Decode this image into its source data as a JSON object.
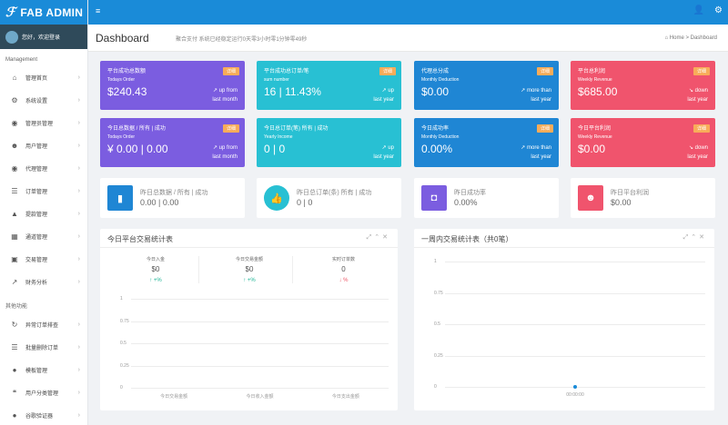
{
  "brand": {
    "name": "FAB ADMIN"
  },
  "user": {
    "greeting": "您好，欢迎登录"
  },
  "sidebar": {
    "section1": "Management",
    "items1": [
      {
        "label": "管理首页",
        "icon": "home-icon",
        "glyph": "⌂"
      },
      {
        "label": "系统设置",
        "icon": "gears-icon",
        "glyph": "⚙"
      },
      {
        "label": "管理员管理",
        "icon": "user-circle-icon",
        "glyph": "◉"
      },
      {
        "label": "用户管理",
        "icon": "users-icon",
        "glyph": "☻"
      },
      {
        "label": "代理管理",
        "icon": "agent-icon",
        "glyph": "◉"
      },
      {
        "label": "订单管理",
        "icon": "list-icon",
        "glyph": "☰"
      },
      {
        "label": "提款管理",
        "icon": "money-bag-icon",
        "glyph": "▲"
      },
      {
        "label": "通道管理",
        "icon": "bank-icon",
        "glyph": "▦"
      },
      {
        "label": "交易管理",
        "icon": "calendar-icon",
        "glyph": "▣"
      },
      {
        "label": "财务分析",
        "icon": "line-chart-icon",
        "glyph": "↗"
      }
    ],
    "section2": "其他功能",
    "items2": [
      {
        "label": "异常订单排查",
        "icon": "refresh-icon",
        "glyph": "↻"
      },
      {
        "label": "批量删除订单",
        "icon": "list-alt-icon",
        "glyph": "☰"
      },
      {
        "label": "模板管理",
        "icon": "apple-icon",
        "glyph": "●"
      },
      {
        "label": "用户分类管理",
        "icon": "comments-icon",
        "glyph": "❝"
      },
      {
        "label": "谷歌验证器",
        "icon": "lock-icon",
        "glyph": "●"
      }
    ]
  },
  "header": {
    "title": "Dashboard",
    "subtitle": "聚合支付 系统已经稳定运行0天零3小时零1分钟零49秒",
    "breadcrumb_home": "Home",
    "breadcrumb_current": "Dashboard"
  },
  "cards_row1": [
    {
      "title": "平台成功总数额",
      "badge": "详细",
      "sub": "Todays Order",
      "value": "$240.43",
      "trend": "up from",
      "trend2": "last month",
      "color": "purple"
    },
    {
      "title": "平台成功总订单/笔",
      "badge": "详细",
      "sub": "sum number",
      "value": "16 | 11.43%",
      "trend": "up",
      "trend2": "last year",
      "color": "cyan"
    },
    {
      "title": "代理总分成",
      "badge": "详细",
      "sub": "Monthly Deduction",
      "value": "$0.00",
      "trend": "more than",
      "trend2": "last year",
      "color": "blue"
    },
    {
      "title": "平台总利润",
      "badge": "详细",
      "sub": "Weekly Revenue",
      "value": "$685.00",
      "trend": "down",
      "trend2": "last year",
      "color": "red"
    }
  ],
  "cards_row2": [
    {
      "title": "今日总数据 / 所有 | 成功",
      "badge": "详细",
      "sub": "Todays Order",
      "value": "¥ 0.00 | 0.00",
      "trend": "up from",
      "trend2": "last month",
      "color": "purple"
    },
    {
      "title": "今日总订单(笔) 所有 | 成功",
      "badge": "",
      "sub": "Yearly Income",
      "value": "0 | 0",
      "trend": "up",
      "trend2": "last year",
      "color": "cyan"
    },
    {
      "title": "今日成功率",
      "badge": "详细",
      "sub": "Monthly Deduction",
      "value": "0.00%",
      "trend": "more than",
      "trend2": "last year",
      "color": "blue"
    },
    {
      "title": "今日平台利润",
      "badge": "详细",
      "sub": "Weekly Revenue",
      "value": "$0.00",
      "trend": "down",
      "trend2": "last year",
      "color": "red"
    }
  ],
  "white_cards": [
    {
      "title": "昨日总数据 / 所有 | 成功",
      "value": "0.00 | 0.00",
      "icon": "bar-chart-icon",
      "glyph": "▮",
      "bg": "#1f86d4"
    },
    {
      "title": "昨日总订单(条) 所有 | 成功",
      "value": "0 | 0",
      "icon": "thumbs-up-icon",
      "glyph": "👍",
      "bg": "#28c0d3"
    },
    {
      "title": "昨日成功率",
      "value": "0.00%",
      "icon": "shopping-bag-icon",
      "glyph": "◘",
      "bg": "#7b5de0"
    },
    {
      "title": "昨日平台利润",
      "value": "$0.00",
      "icon": "users-icon",
      "glyph": "☻",
      "bg": "#f0546d"
    }
  ],
  "panel_left": {
    "title": "今日平台交易统计表",
    "stats": [
      {
        "label": "今日入金",
        "value": "$0",
        "pct": "+%",
        "dir": "up"
      },
      {
        "label": "今日交易金额",
        "value": "$0",
        "pct": "+%",
        "dir": "up"
      },
      {
        "label": "实时订单数",
        "value": "0",
        "pct": "%",
        "dir": "down"
      }
    ],
    "chart_data": {
      "type": "bar",
      "categories": [
        "今日交易金额",
        "今日收入金额",
        "今日支出金额"
      ],
      "values": [
        0,
        0,
        0
      ],
      "ylim": [
        0,
        1
      ],
      "yticks": [
        "1",
        "0.75",
        "0.5",
        "0.25",
        "0"
      ]
    }
  },
  "panel_right": {
    "title": "一周内交易统计表（共0笔）",
    "chart_data": {
      "type": "line",
      "x": [
        "00:00:00"
      ],
      "values": [
        0
      ],
      "ylim": [
        0,
        1
      ],
      "yticks": [
        "1",
        "0.75",
        "0.5",
        "0.25",
        "0"
      ]
    }
  }
}
